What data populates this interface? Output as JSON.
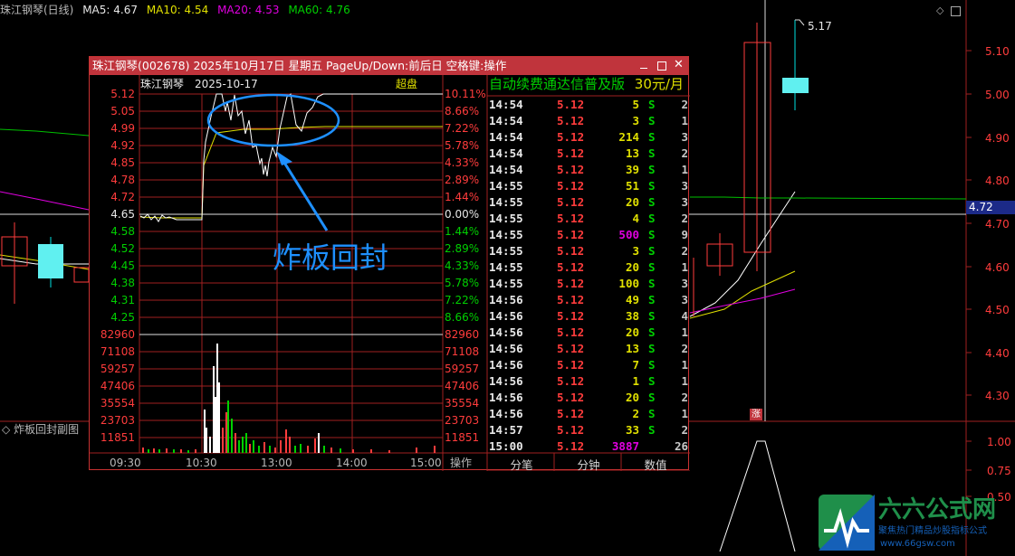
{
  "main_chart": {
    "title": "珠江钢琴(日线)",
    "ma5": "MA5: 4.67",
    "ma10": "MA10: 4.54",
    "ma20": "MA20: 4.53",
    "ma60": "MA60: 4.76",
    "high_label": "5.17",
    "price_axis": [
      "5.10",
      "5.00",
      "4.90",
      "4.80",
      "4.70",
      "4.60",
      "4.50",
      "4.40",
      "4.30"
    ],
    "current_price": "4.72",
    "limit_badge": "涨",
    "indicator_title": "炸板回封副图",
    "indicator_axis": [
      "1.00",
      "0.75",
      "0.50"
    ]
  },
  "popup": {
    "title": "珠江钢琴(002678) 2025年10月17日 星期五 PageUp/Down:前后日 空格键:操作",
    "stock_name": "珠江钢琴",
    "date": "2025-10-17",
    "super_label": "超盘",
    "price_ticks": [
      "5.12",
      "5.05",
      "4.99",
      "4.92",
      "4.85",
      "4.78",
      "4.72",
      "4.65",
      "4.58",
      "4.52",
      "4.45",
      "4.38",
      "4.31",
      "4.25"
    ],
    "pct_ticks": [
      "10.11%",
      "8.66%",
      "7.22%",
      "5.78%",
      "4.33%",
      "2.89%",
      "1.44%",
      "0.00%",
      "1.44%",
      "2.89%",
      "4.33%",
      "5.78%",
      "7.22%",
      "8.66%"
    ],
    "volume_ticks": [
      "82960",
      "71108",
      "59257",
      "47406",
      "35554",
      "23703",
      "11851"
    ],
    "time_ticks": [
      "09:30",
      "10:30",
      "13:00",
      "14:00",
      "15:00"
    ],
    "operate_label": "操作",
    "annotation": "炸板回封",
    "ad_title": "自动续费通达信普及版",
    "ad_price": "30元/月",
    "ticks": [
      {
        "time": "14:54",
        "price": "5.12",
        "vol": "5",
        "side": "S",
        "n": "2"
      },
      {
        "time": "14:54",
        "price": "5.12",
        "vol": "3",
        "side": "S",
        "n": "1"
      },
      {
        "time": "14:54",
        "price": "5.12",
        "vol": "214",
        "side": "S",
        "n": "3"
      },
      {
        "time": "14:54",
        "price": "5.12",
        "vol": "13",
        "side": "S",
        "n": "2"
      },
      {
        "time": "14:54",
        "price": "5.12",
        "vol": "39",
        "side": "S",
        "n": "1"
      },
      {
        "time": "14:55",
        "price": "5.12",
        "vol": "51",
        "side": "S",
        "n": "3"
      },
      {
        "time": "14:55",
        "price": "5.12",
        "vol": "20",
        "side": "S",
        "n": "3"
      },
      {
        "time": "14:55",
        "price": "5.12",
        "vol": "4",
        "side": "S",
        "n": "2"
      },
      {
        "time": "14:55",
        "price": "5.12",
        "vol": "500",
        "side": "S",
        "n": "9"
      },
      {
        "time": "14:55",
        "price": "5.12",
        "vol": "3",
        "side": "S",
        "n": "2"
      },
      {
        "time": "14:55",
        "price": "5.12",
        "vol": "20",
        "side": "S",
        "n": "1"
      },
      {
        "time": "14:55",
        "price": "5.12",
        "vol": "100",
        "side": "S",
        "n": "3"
      },
      {
        "time": "14:56",
        "price": "5.12",
        "vol": "49",
        "side": "S",
        "n": "3"
      },
      {
        "time": "14:56",
        "price": "5.12",
        "vol": "38",
        "side": "S",
        "n": "4"
      },
      {
        "time": "14:56",
        "price": "5.12",
        "vol": "20",
        "side": "S",
        "n": "1"
      },
      {
        "time": "14:56",
        "price": "5.12",
        "vol": "13",
        "side": "S",
        "n": "2"
      },
      {
        "time": "14:56",
        "price": "5.12",
        "vol": "7",
        "side": "S",
        "n": "1"
      },
      {
        "time": "14:56",
        "price": "5.12",
        "vol": "1",
        "side": "S",
        "n": "1"
      },
      {
        "time": "14:56",
        "price": "5.12",
        "vol": "20",
        "side": "S",
        "n": "2"
      },
      {
        "time": "14:56",
        "price": "5.12",
        "vol": "2",
        "side": "S",
        "n": "1"
      },
      {
        "time": "14:57",
        "price": "5.12",
        "vol": "33",
        "side": "S",
        "n": "2"
      },
      {
        "time": "15:00",
        "price": "5.12",
        "vol": "3887",
        "side": "",
        "n": "26"
      }
    ],
    "tabs": [
      "分笔",
      "分钟",
      "数值"
    ]
  },
  "watermark": {
    "brand": "六六公式网",
    "slogan": "聚焦热门精品炒股指标公式",
    "url": "www.66gsw.com"
  },
  "colors": {
    "up": "#ff3c3c",
    "down": "#00d000",
    "ma5": "#ffffff",
    "ma10": "#e0e000",
    "ma20": "#e000e0",
    "ma60": "#00d000",
    "annotation": "#1e90ff",
    "title_bar": "#c0343c"
  }
}
